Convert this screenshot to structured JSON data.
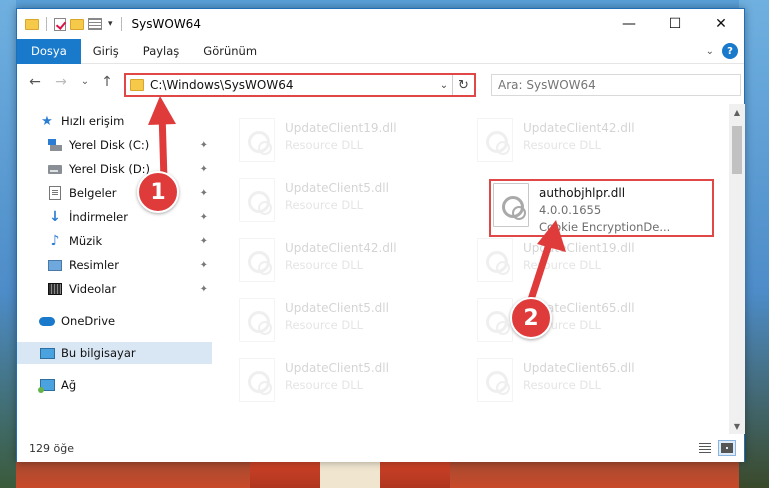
{
  "window": {
    "title": "SysWOW64",
    "controls": {
      "minimize": "—",
      "maximize": "☐",
      "close": "✕"
    }
  },
  "ribbon": {
    "tabs": [
      "Dosya",
      "Giriş",
      "Paylaş",
      "Görünüm"
    ],
    "expand": "⌄",
    "help": "?"
  },
  "address": {
    "back": "←",
    "forward": "→",
    "recent": "⌄",
    "up": "↑",
    "path": "C:\\Windows\\SysWOW64",
    "dropdown": "⌄",
    "refresh": "↻"
  },
  "search": {
    "placeholder": "Ara: SysWOW64"
  },
  "sidebar": {
    "items": [
      {
        "label": "Hızlı erişim",
        "icon": "star-icon",
        "pinned": false
      },
      {
        "label": "Yerel Disk (C:)",
        "icon": "drive-icon",
        "pinned": true
      },
      {
        "label": "Yerel Disk (D:)",
        "icon": "drive-icon",
        "pinned": true
      },
      {
        "label": "Belgeler",
        "icon": "documents-icon",
        "pinned": true
      },
      {
        "label": "İndirmeler",
        "icon": "download-icon",
        "pinned": true
      },
      {
        "label": "Müzik",
        "icon": "music-icon",
        "pinned": true
      },
      {
        "label": "Resimler",
        "icon": "pictures-icon",
        "pinned": true
      },
      {
        "label": "Videolar",
        "icon": "videos-icon",
        "pinned": true
      },
      {
        "label": "OneDrive",
        "icon": "cloud-icon",
        "pinned": false
      },
      {
        "label": "Bu bilgisayar",
        "icon": "computer-icon",
        "pinned": false,
        "selected": true
      },
      {
        "label": "Ağ",
        "icon": "network-icon",
        "pinned": false
      }
    ],
    "pin_glyph": "📌"
  },
  "files": {
    "highlighted": {
      "name": "authobjhlpr.dll",
      "version": "4.0.0.1655",
      "description": "Cookie EncryptionDe..."
    },
    "faded": [
      {
        "name": "UpdateClient19.dll",
        "type": "Resource DLL"
      },
      {
        "name": "UpdateClient42.dll",
        "type": "Resource DLL"
      },
      {
        "name": "UpdateClient5.dll",
        "type": "Resource DLL"
      },
      {
        "name": "UpdateClient42.dll",
        "type": "Resource DLL"
      },
      {
        "name": "UpdateClient19.dll",
        "type": "Resource DLL"
      },
      {
        "name": "UpdateClient5.dll",
        "type": "Resource DLL"
      },
      {
        "name": "UpdateClient65.dll",
        "type": "Resource DLL"
      },
      {
        "name": "UpdateClient5.dll",
        "type": "Resource DLL"
      },
      {
        "name": "UpdateClient65.dll",
        "type": "Resource DLL"
      }
    ]
  },
  "status": {
    "count": "129 öğe"
  },
  "annotations": {
    "step1": "1",
    "step2": "2",
    "color": "#e03b3b"
  }
}
